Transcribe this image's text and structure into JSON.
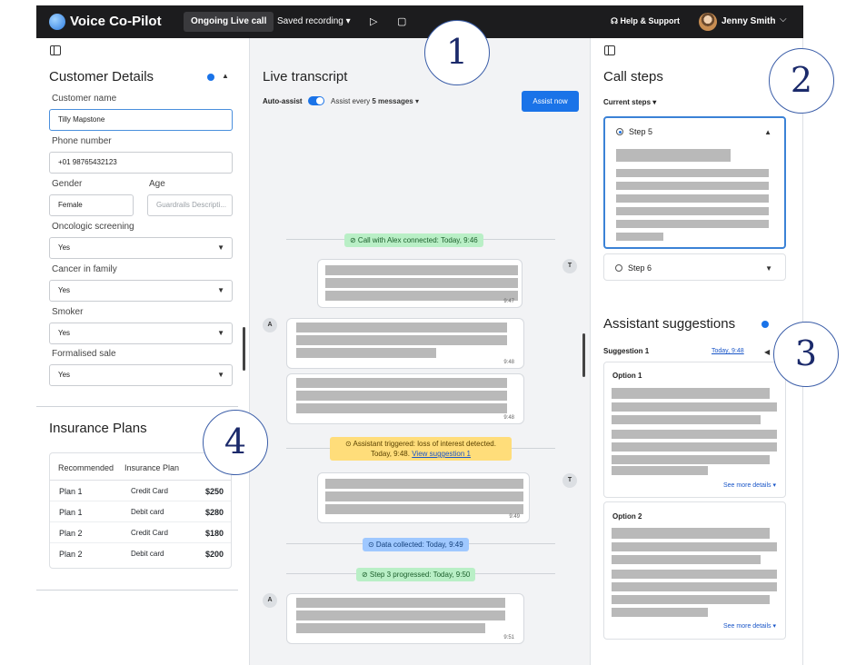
{
  "topbar": {
    "app_title": "Voice Co-Pilot",
    "tabs": [
      {
        "label": "Ongoing Live call"
      },
      {
        "label": "Saved recording ▾"
      }
    ],
    "play_icon": "▷",
    "stop_icon": "▢",
    "help_label": "Help & Support",
    "user_name": "Jenny Smith",
    "chevron": "⌵"
  },
  "customer": {
    "title": "Customer Details",
    "fields": {
      "name_label": "Customer name",
      "name_value": "Tilly Mapstone",
      "phone_label": "Phone number",
      "phone_value": "+01 98765432123",
      "gender_label": "Gender",
      "gender_value": "Female",
      "age_label": "Age",
      "age_placeholder": "Guardrails Descripti...",
      "onco_label": "Oncologic screening",
      "onco_value": "Yes",
      "cancer_label": "Cancer in family",
      "cancer_value": "Yes",
      "smoker_label": "Smoker",
      "smoker_value": "Yes",
      "sale_label": "Formalised sale",
      "sale_value": "Yes"
    }
  },
  "insurance": {
    "title": "Insurance Plans",
    "headers": [
      "Recommended",
      "Insurance Plan"
    ],
    "rows": [
      {
        "plan": "Plan 1",
        "type": "Credit Card",
        "price": "$250"
      },
      {
        "plan": "Plan 1",
        "type": "Debit card",
        "price": "$280"
      },
      {
        "plan": "Plan 2",
        "type": "Credit Card",
        "price": "$180"
      },
      {
        "plan": "Plan 2",
        "type": "Debit card",
        "price": "$200"
      }
    ]
  },
  "transcript": {
    "title": "Live transcript",
    "auto_assist": "Auto-assist",
    "assist_every": "Assist every",
    "assist_count": "5 messages",
    "assist_now": "Assist now",
    "events": {
      "connected": "⊘ Call with Alex connected: Today, 9:46",
      "triggered_line1": "⊙ Assistant triggered: loss of interest detected.",
      "triggered_line2": "Today, 9:48.",
      "triggered_link": "View suggestion 1",
      "data_collected": "⊙ Data collected: Today, 9:49",
      "step_progressed": "⊘ Step 3 progressed: Today, 9:50"
    },
    "avatars": {
      "agent": "T",
      "customer": "A"
    },
    "times": [
      "9:47",
      "9:48",
      "9:48",
      "9:49",
      "9:51"
    ]
  },
  "steps": {
    "title": "Call steps",
    "current_label": "Current steps",
    "step5": "Step 5",
    "step6": "Step 6"
  },
  "suggestions": {
    "title": "Assistant suggestions",
    "suggestion_label": "Suggestion 1",
    "suggestion_time": "Today, 9:48",
    "option1": "Option 1",
    "option2": "Option 2",
    "see_more": "See more details ▾"
  },
  "callouts": [
    "1",
    "2",
    "3",
    "4"
  ],
  "colors": {
    "accent": "#1a73e8",
    "topbar": "#1c1c1e",
    "event_green": "#b9efc6",
    "event_yellow": "#ffdd7a",
    "event_blue": "#9fc8ff"
  }
}
